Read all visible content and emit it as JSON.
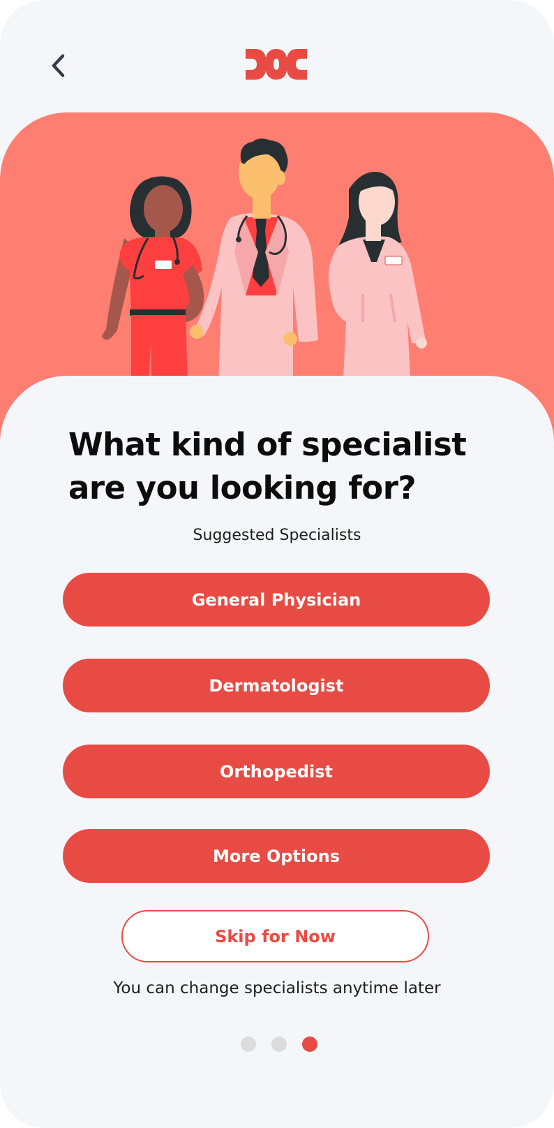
{
  "header": {
    "back_icon": "chevron-left-icon",
    "logo_icon": "doc-logo-icon"
  },
  "hero": {
    "illustration": "three-doctors-illustration"
  },
  "main": {
    "title": "What kind of specialist are you looking for?",
    "subtitle": "Suggested Specialists",
    "options": [
      {
        "label": "General Physician"
      },
      {
        "label": "Dermatologist"
      },
      {
        "label": "Orthopedist"
      },
      {
        "label": "More Options"
      }
    ],
    "skip_label": "Skip for Now",
    "note": "You can change specialists anytime later"
  },
  "pagination": {
    "total": 3,
    "current": 3
  },
  "colors": {
    "accent": "#e84b43",
    "hero_background": "#fe7f71",
    "page_background": "#f5f6fa"
  }
}
